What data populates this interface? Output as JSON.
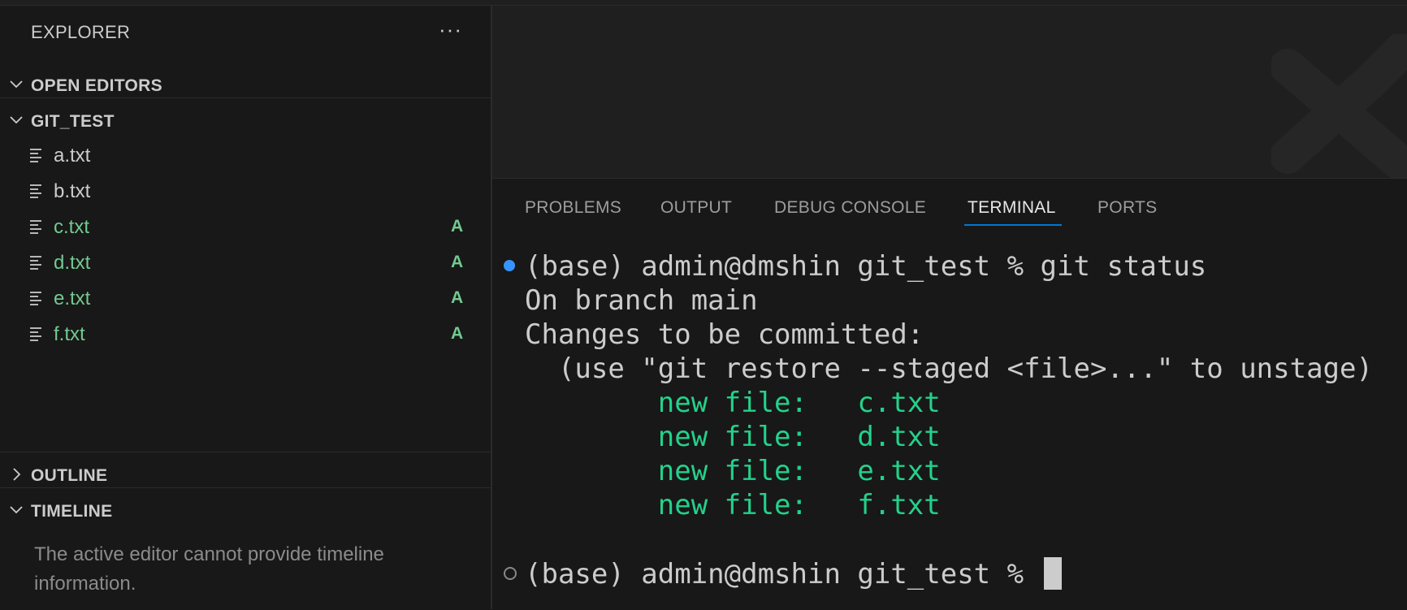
{
  "sidebar": {
    "header": "EXPLORER",
    "more_label": "···",
    "sections": {
      "open_editors": "OPEN EDITORS",
      "workspace": "GIT_TEST",
      "outline": "OUTLINE",
      "timeline": "TIMELINE"
    },
    "files": [
      {
        "name": "a.txt",
        "badge": ""
      },
      {
        "name": "b.txt",
        "badge": ""
      },
      {
        "name": "c.txt",
        "badge": "A"
      },
      {
        "name": "d.txt",
        "badge": "A"
      },
      {
        "name": "e.txt",
        "badge": "A"
      },
      {
        "name": "f.txt",
        "badge": "A"
      }
    ],
    "timeline_message": "The active editor cannot provide timeline information."
  },
  "panel": {
    "tabs": [
      "PROBLEMS",
      "OUTPUT",
      "DEBUG CONSOLE",
      "TERMINAL",
      "PORTS"
    ],
    "active_tab": "TERMINAL"
  },
  "terminal": {
    "lines": [
      "(base) admin@dmshin git_test % git status",
      "On branch main",
      "Changes to be committed:",
      "  (use \"git restore --staged <file>...\" to unstage)",
      "        new file:   c.txt",
      "        new file:   d.txt",
      "        new file:   e.txt",
      "        new file:   f.txt",
      "(base) admin@dmshin git_test % "
    ]
  },
  "colors": {
    "added": "#73c991",
    "terminal_green": "#23d18b",
    "accent": "#0078d4"
  }
}
